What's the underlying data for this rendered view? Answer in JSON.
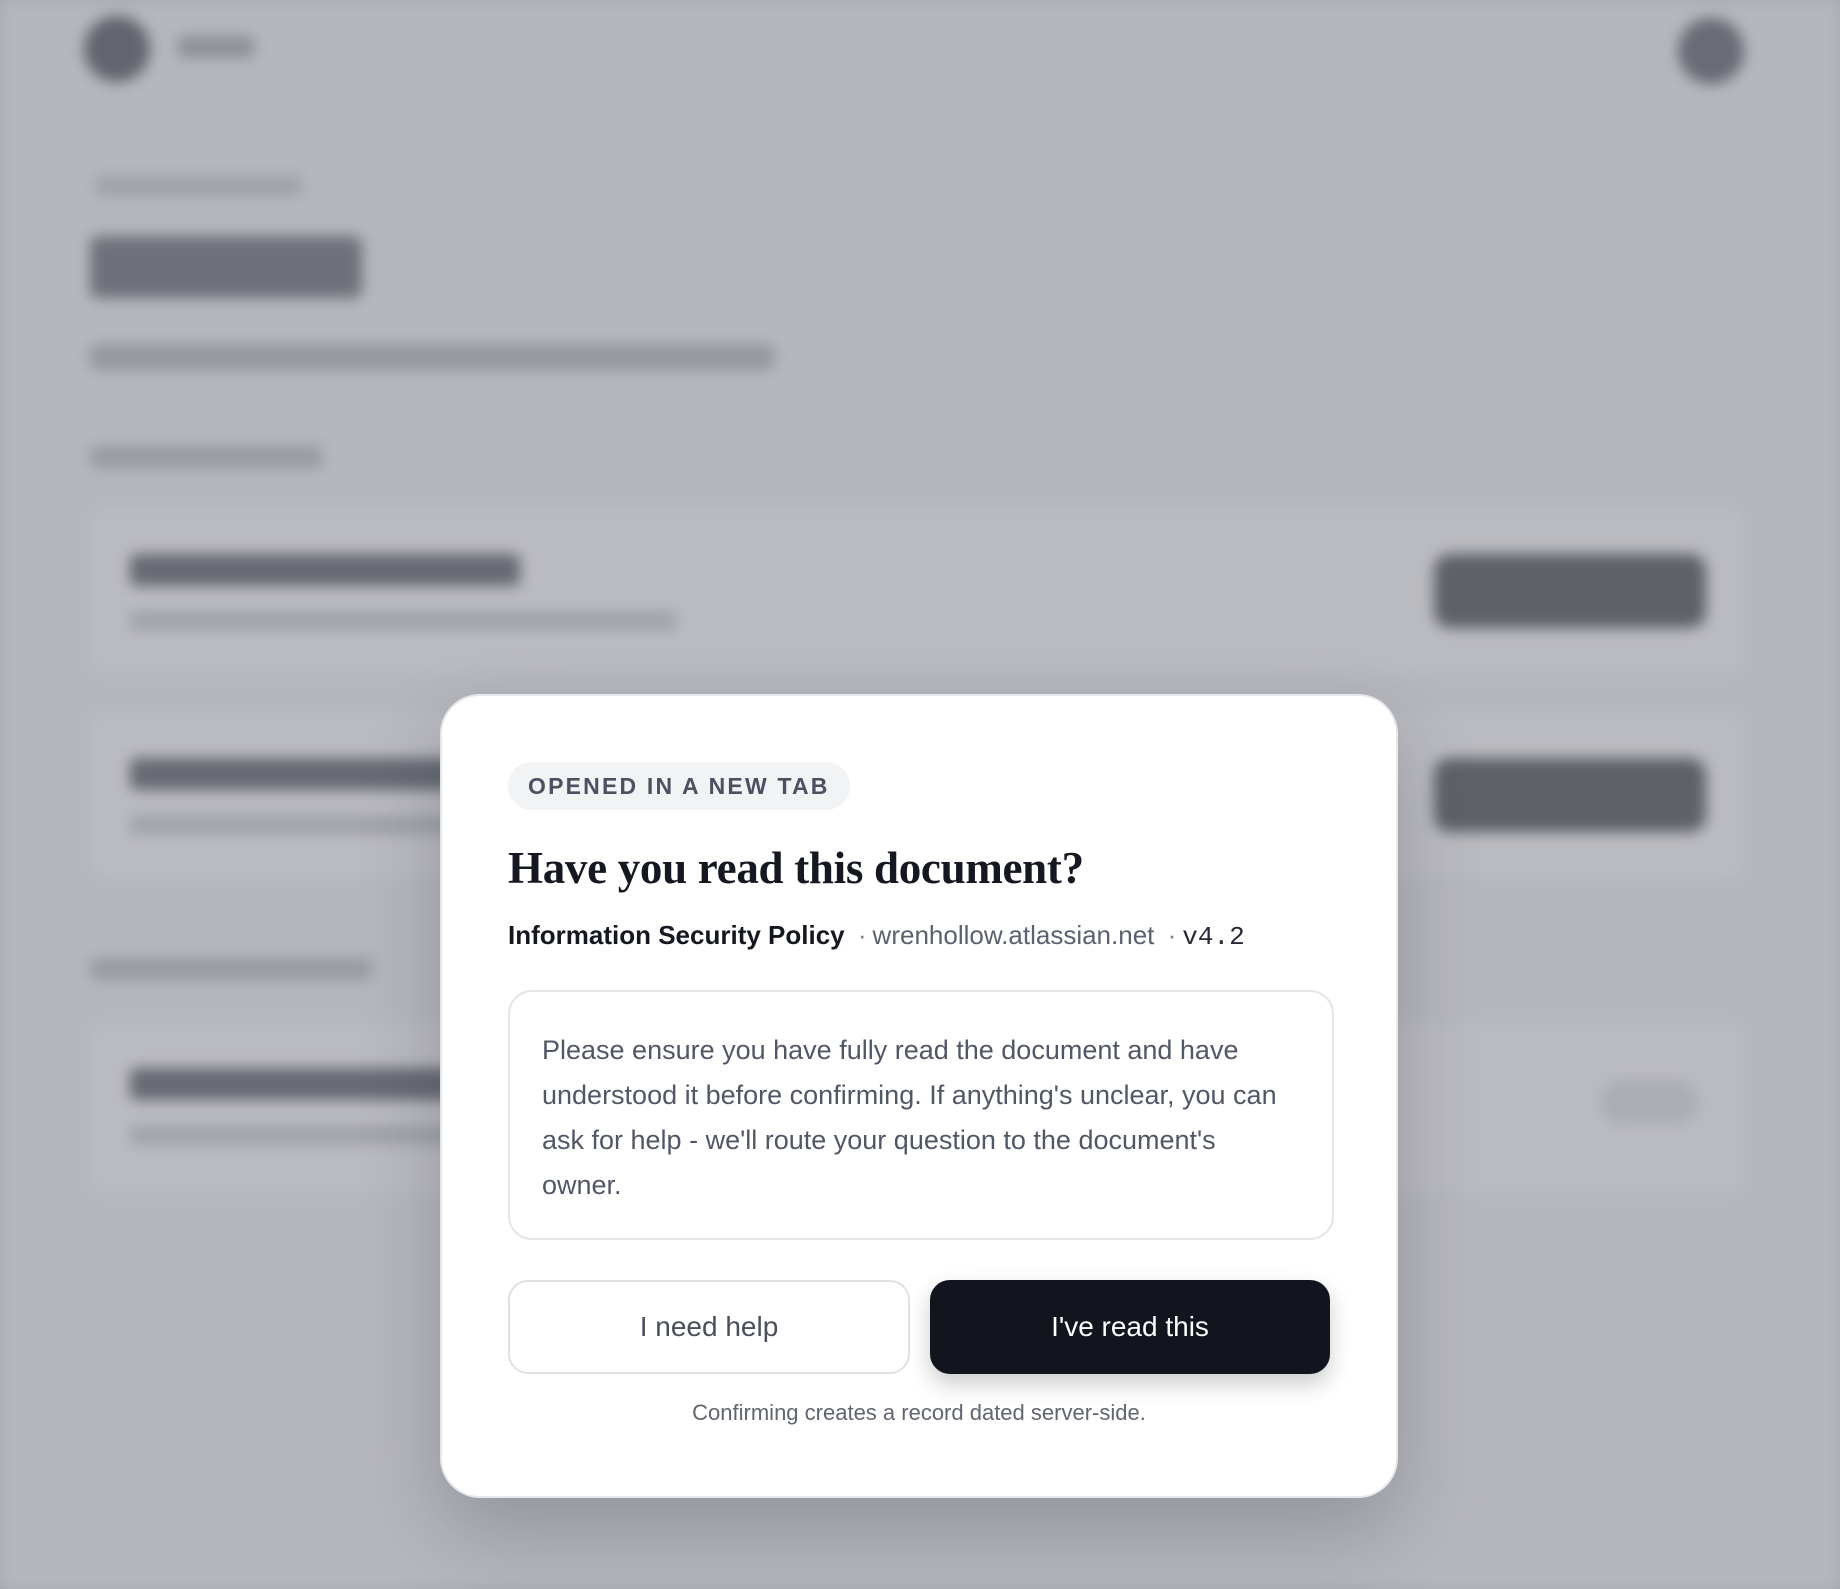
{
  "modal": {
    "badge": "OPENED IN A NEW TAB",
    "title": "Have you read this document?",
    "document": {
      "name": "Information Security Policy",
      "separator": "·",
      "site": "wrenhollow.atlassian.net",
      "version": "v4.2"
    },
    "message": "Please ensure you have fully read the document and have understood it before confirming. If anything's unclear, you can ask for help - we'll route your question to the document's owner.",
    "secondary_button": "I need help",
    "primary_button": "I've read this",
    "footnote": "Confirming creates a record dated server-side."
  },
  "colors": {
    "primary_button": "#12151d",
    "scrim": "#8f929a",
    "badge_bg": "#f2f3f5"
  }
}
